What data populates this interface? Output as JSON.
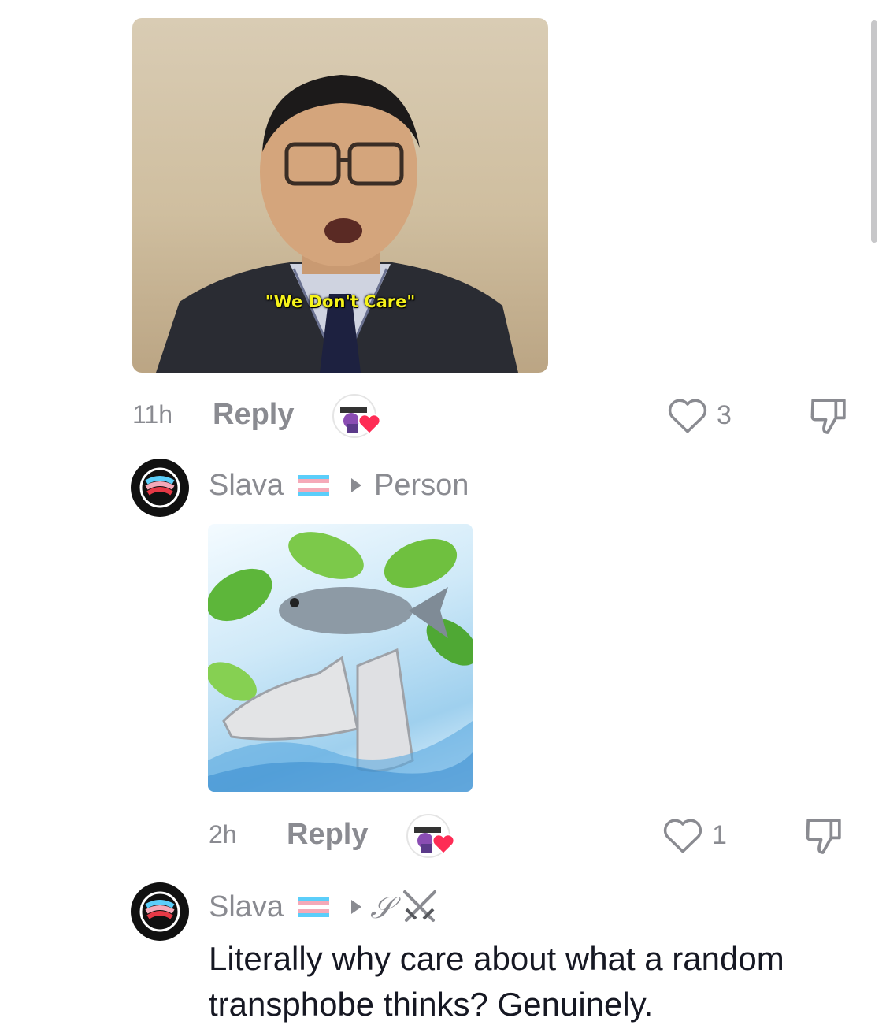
{
  "comment_1": {
    "media_caption": "\"We Don't Care\"",
    "time": "11h",
    "reply_label": "Reply",
    "like_count": "3",
    "like_icon": "heart-outline-icon",
    "dislike_icon": "thumbs-down-icon"
  },
  "comment_2": {
    "username": "Slava",
    "flag": "transgender-flag",
    "reply_to": "Person",
    "time": "2h",
    "reply_label": "Reply",
    "like_count": "1",
    "like_icon": "heart-outline-icon",
    "dislike_icon": "thumbs-down-icon"
  },
  "comment_3": {
    "username": "Slava",
    "flag": "transgender-flag",
    "reply_to": "𝒮",
    "reply_to_icon": "crossed-swords-icon",
    "text": "Literally why care about what a random transphobe thinks? Genuinely."
  },
  "colors": {
    "muted_text": "#8a8b91",
    "body_text": "#161823",
    "heart_red": "#fe2c55",
    "caption_yellow": "#f6f31a",
    "flag_blue": "#5bcefa",
    "flag_pink": "#f5a9b8"
  }
}
